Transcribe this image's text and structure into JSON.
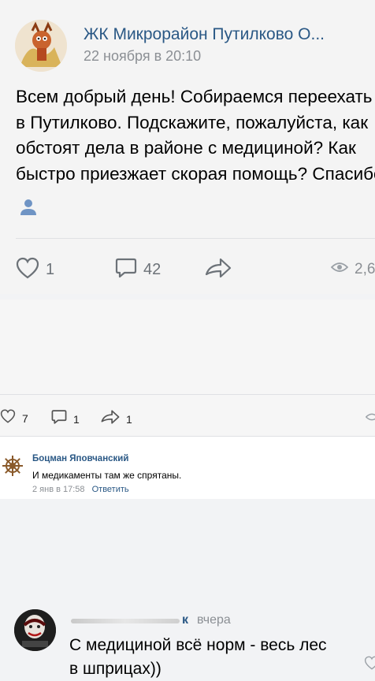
{
  "post": {
    "author": "ЖК Микрорайон Путилково О...",
    "time": "22 ноября в 20:10",
    "text_lines": [
      "Всем добрый день! Собираемся переехать",
      "в Путилково. Подскажите, пожалуйста, как",
      "обстоят дела в районе с медициной? Как",
      "быстро приезжает скорая помощь? Спасибо"
    ],
    "likes": "1",
    "comments": "42",
    "views": "2,6"
  },
  "comment1": {
    "author_suffix": "к",
    "time": "вчера",
    "text_lines": [
      "С медициной всё норм - весь лес",
      "в шприцах))"
    ],
    "likes": "7",
    "replies": "1",
    "shares": "1"
  },
  "comment2": {
    "author": "Боцман Яповчанский",
    "text": "И медикаменты там же спрятаны.",
    "time": "2 янв в 17:58",
    "reply_label": "Ответить"
  },
  "colors": {
    "link": "#2a5885",
    "meta": "#8b8f94",
    "icon": "#6c7278"
  }
}
